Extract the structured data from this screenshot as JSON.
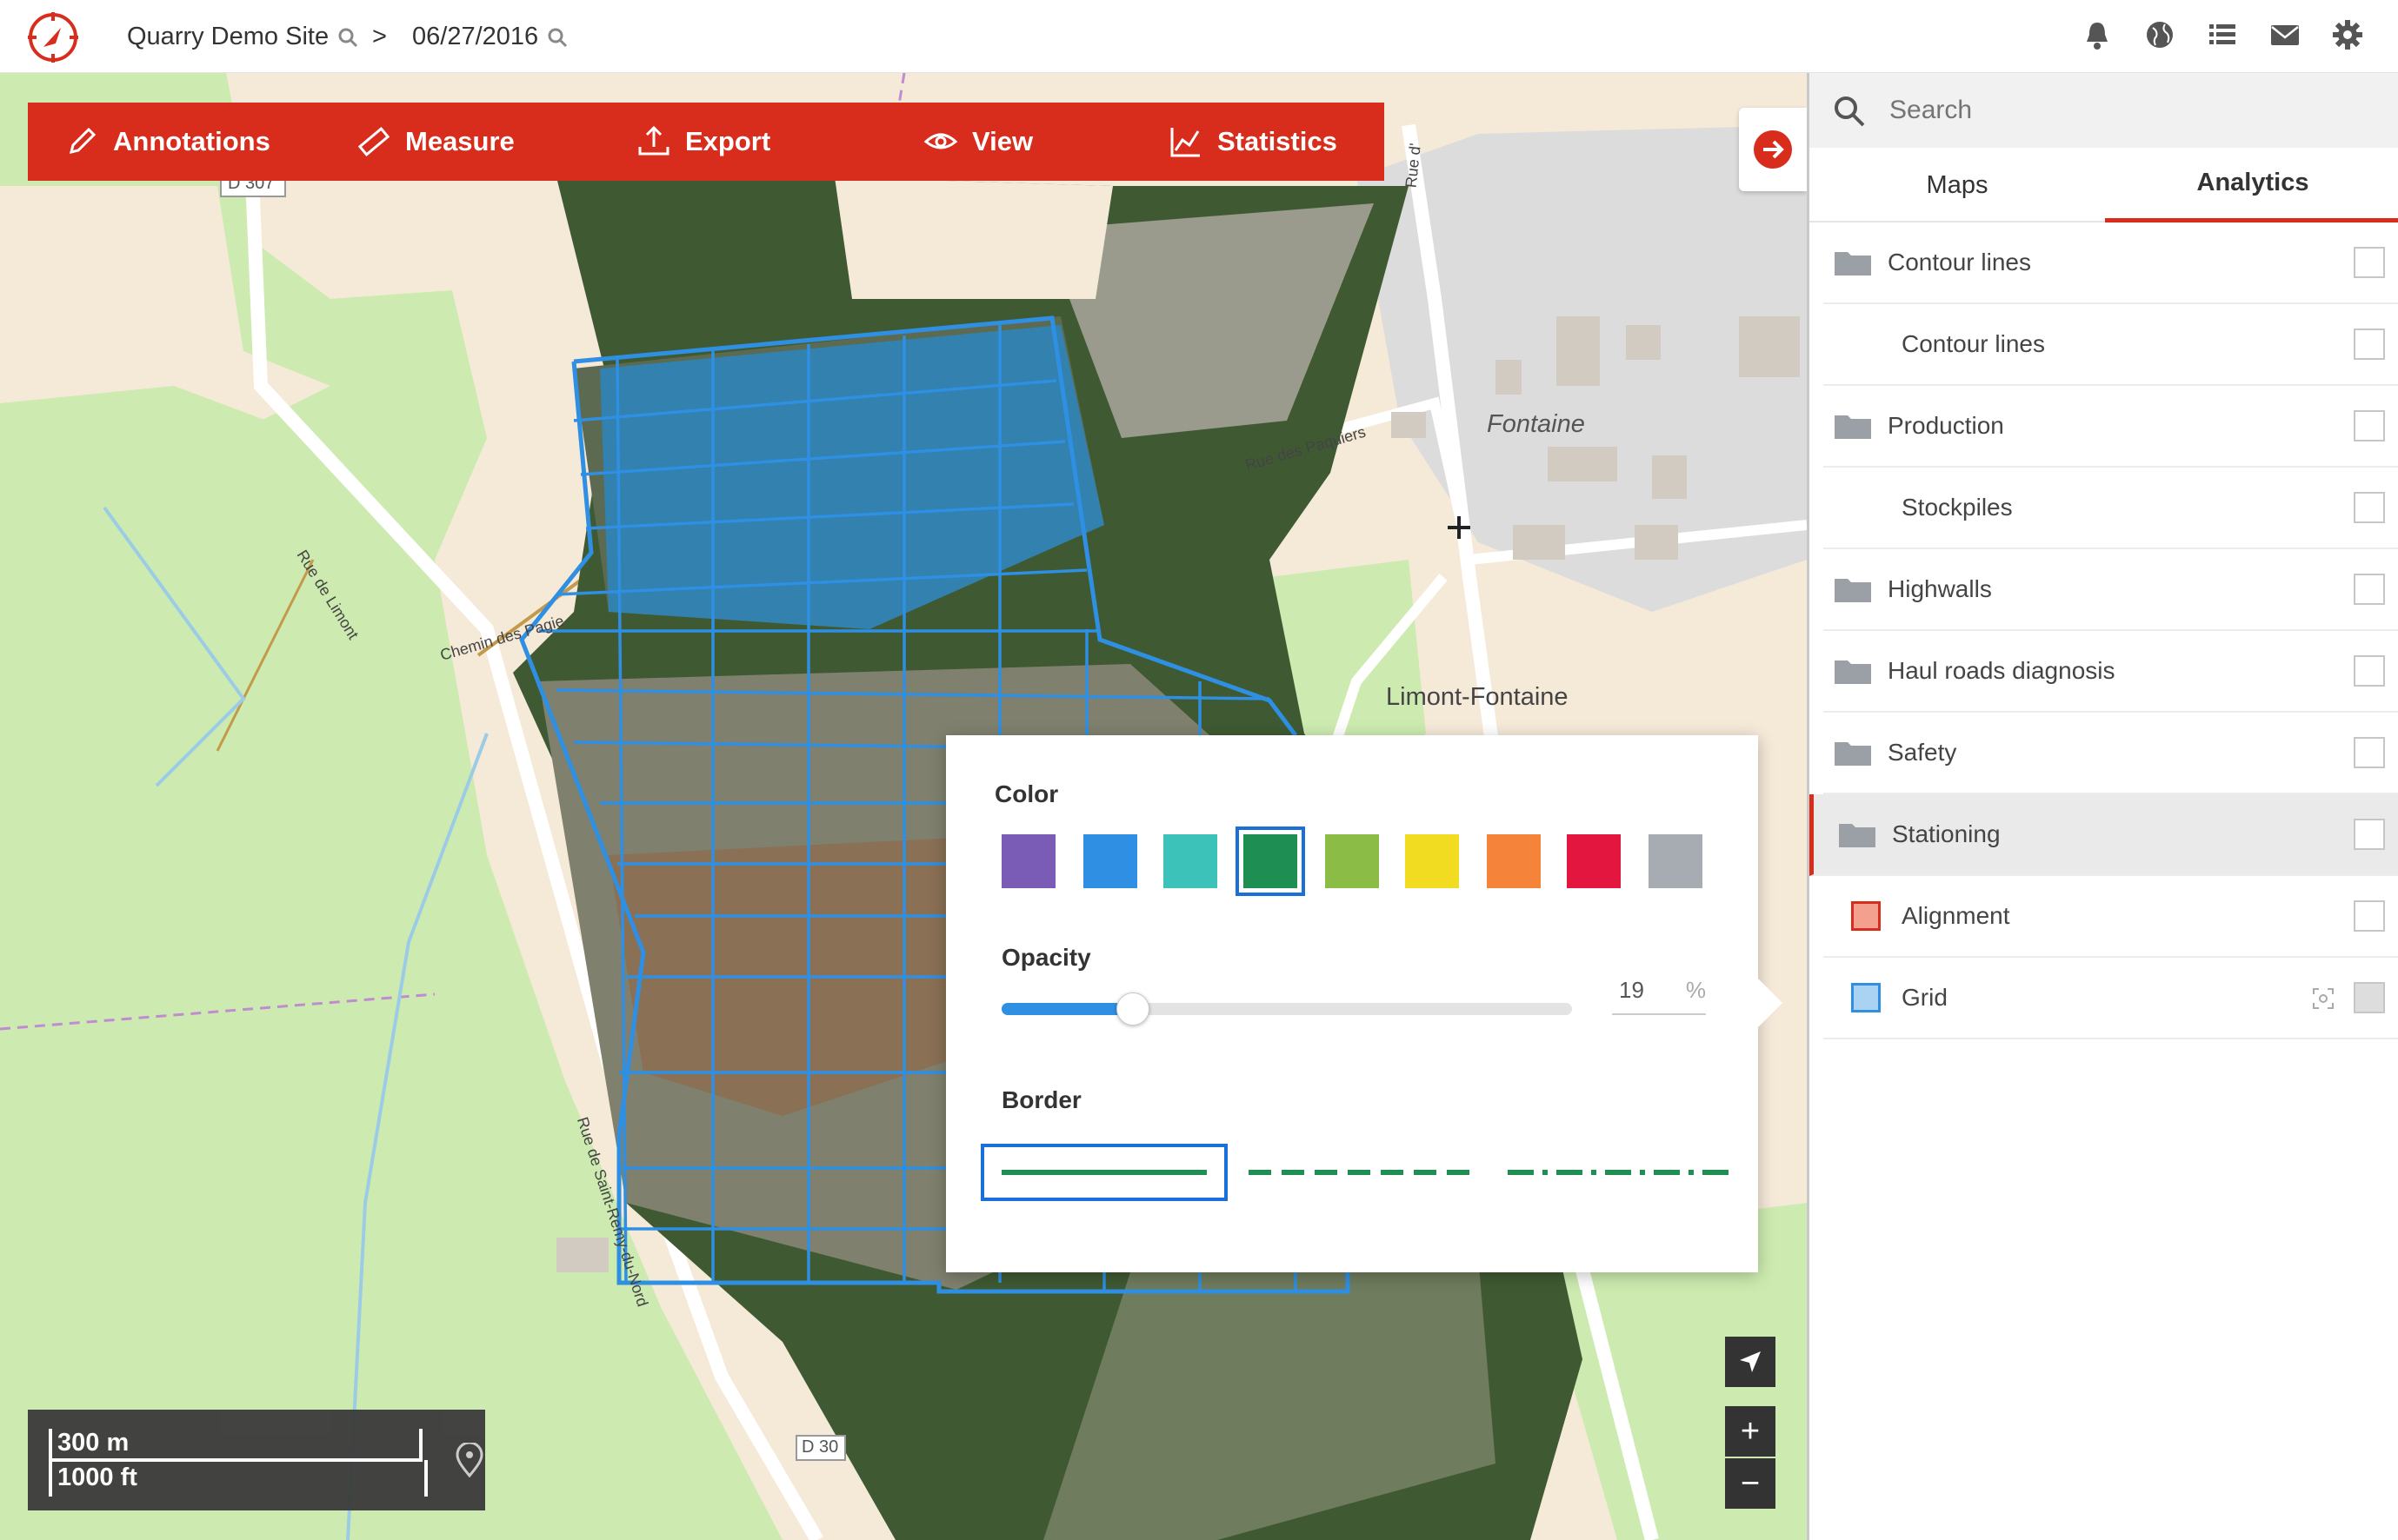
{
  "header": {
    "site": "Quarry Demo Site",
    "separator": ">",
    "date": "06/27/2016"
  },
  "toolbar": {
    "annotations": "Annotations",
    "measure": "Measure",
    "export": "Export",
    "view": "View",
    "statistics": "Statistics"
  },
  "map_labels": {
    "fontaine": "Fontaine",
    "limont": "Limont-Fontaine",
    "d307": "D 307",
    "d30": "D 30",
    "rue_paquiers": "Rue des Paquiers",
    "chemin": "Chemin des Pagie",
    "rue_limont": "Rue de Limont",
    "rue_nord": "Rue de Saint-Remy-du-Nord",
    "rue_top": "Rue d'"
  },
  "popup": {
    "color_label": "Color",
    "colors": [
      "#7a5bb5",
      "#2f8fe3",
      "#3cc2b8",
      "#1e8e52",
      "#8bbd46",
      "#f1dc21",
      "#f5833a",
      "#e3163f",
      "#a7acb3"
    ],
    "selected_color_index": 3,
    "opacity_label": "Opacity",
    "opacity_value": "19",
    "opacity_unit": "%",
    "opacity_fraction": 0.23,
    "border_label": "Border",
    "border_styles": [
      "solid",
      "dashed",
      "dash-dot"
    ],
    "selected_border_index": 0,
    "line_color": "#1e8e52"
  },
  "sidebar": {
    "search_placeholder": "Search",
    "tabs": [
      "Maps",
      "Analytics"
    ],
    "active_tab": "Analytics",
    "layers": [
      {
        "label": "Contour lines",
        "kind": "folder"
      },
      {
        "label": "Contour lines",
        "kind": "child"
      },
      {
        "label": "Production",
        "kind": "folder"
      },
      {
        "label": "Stockpiles",
        "kind": "child"
      },
      {
        "label": "Highwalls",
        "kind": "folder"
      },
      {
        "label": "Haul roads diagnosis",
        "kind": "folder"
      },
      {
        "label": "Safety",
        "kind": "folder"
      },
      {
        "label": "Stationing",
        "kind": "folder"
      },
      {
        "label": "Alignment",
        "kind": "child"
      },
      {
        "label": "Grid",
        "kind": "child"
      }
    ]
  },
  "scale": {
    "metric": "300 m",
    "imperial": "1000 ft"
  },
  "zoom": {
    "in": "+",
    "out": "−"
  },
  "colors": {
    "accent": "#d82d1d",
    "selection": "#1a70d8",
    "grid_line": "#2f8fe3"
  }
}
